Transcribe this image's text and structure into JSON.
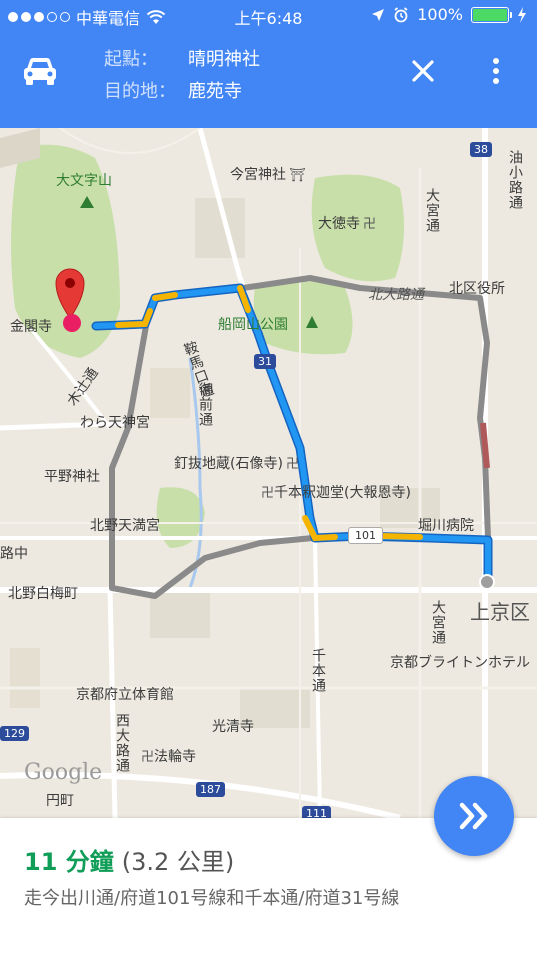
{
  "status_bar": {
    "carrier": "中華電信",
    "time": "上午6:48",
    "battery": "100%",
    "battery_color": "#4cd964"
  },
  "header": {
    "background": "#4285f4",
    "mode_icon": "car-icon",
    "origin_label": "起點：",
    "origin": "晴明神社",
    "destination_label": "目的地：",
    "destination": "鹿苑寺",
    "close_icon": "close-icon",
    "menu_icon": "more-vert-icon"
  },
  "map": {
    "labels": {
      "daimonji": "大文字山",
      "imamiya": "今宮神社",
      "daitokuji": "大徳寺",
      "kinkakuji": "金閣寺",
      "funaoka": "船岡山公園",
      "kitaoji": "北大路通",
      "kitaku": "北区役所",
      "kuramaguchi": "鞍馬口通",
      "gozen": "御前通",
      "kinugasa": "木辻通",
      "waratenjin": "わら天神宮",
      "hirano": "平野神社",
      "kuginuki": "釘抜地蔵(石像寺)",
      "senbon_shaka": "千本釈迦堂(大報恩寺)",
      "kitano_tenmangu": "北野天満宮",
      "horikawa_hospital": "堀川病院",
      "school": "路中",
      "kitano_hakubai": "北野白梅町",
      "kamigyo": "上京区",
      "bright": "京都ブライトンホテル",
      "gymnasium": "京都府立体育館",
      "kosei": "光清寺",
      "horinji": "法輪寺",
      "senbondori": "千本通",
      "nishioji": "西大路通",
      "omiya": "大宮通",
      "aburanokoji": "油小路通",
      "omiya2": "大宮通",
      "enmachi": "円町",
      "google": "Google"
    },
    "shields": {
      "r38": "38",
      "r31": "31",
      "r101": "101",
      "r129": "129",
      "r187": "187",
      "r111": "111"
    },
    "route_colors": {
      "fast": "#2196f3",
      "slow": "#f4b400",
      "alt": "#8a8a8a"
    },
    "locate_icon": "my-location-icon",
    "start_icon": "navigation-start-icon"
  },
  "result": {
    "duration": "11 分鐘",
    "distance": "(3.2 公里)",
    "via": "走今出川通/府道101号線和千本通/府道31号線"
  }
}
